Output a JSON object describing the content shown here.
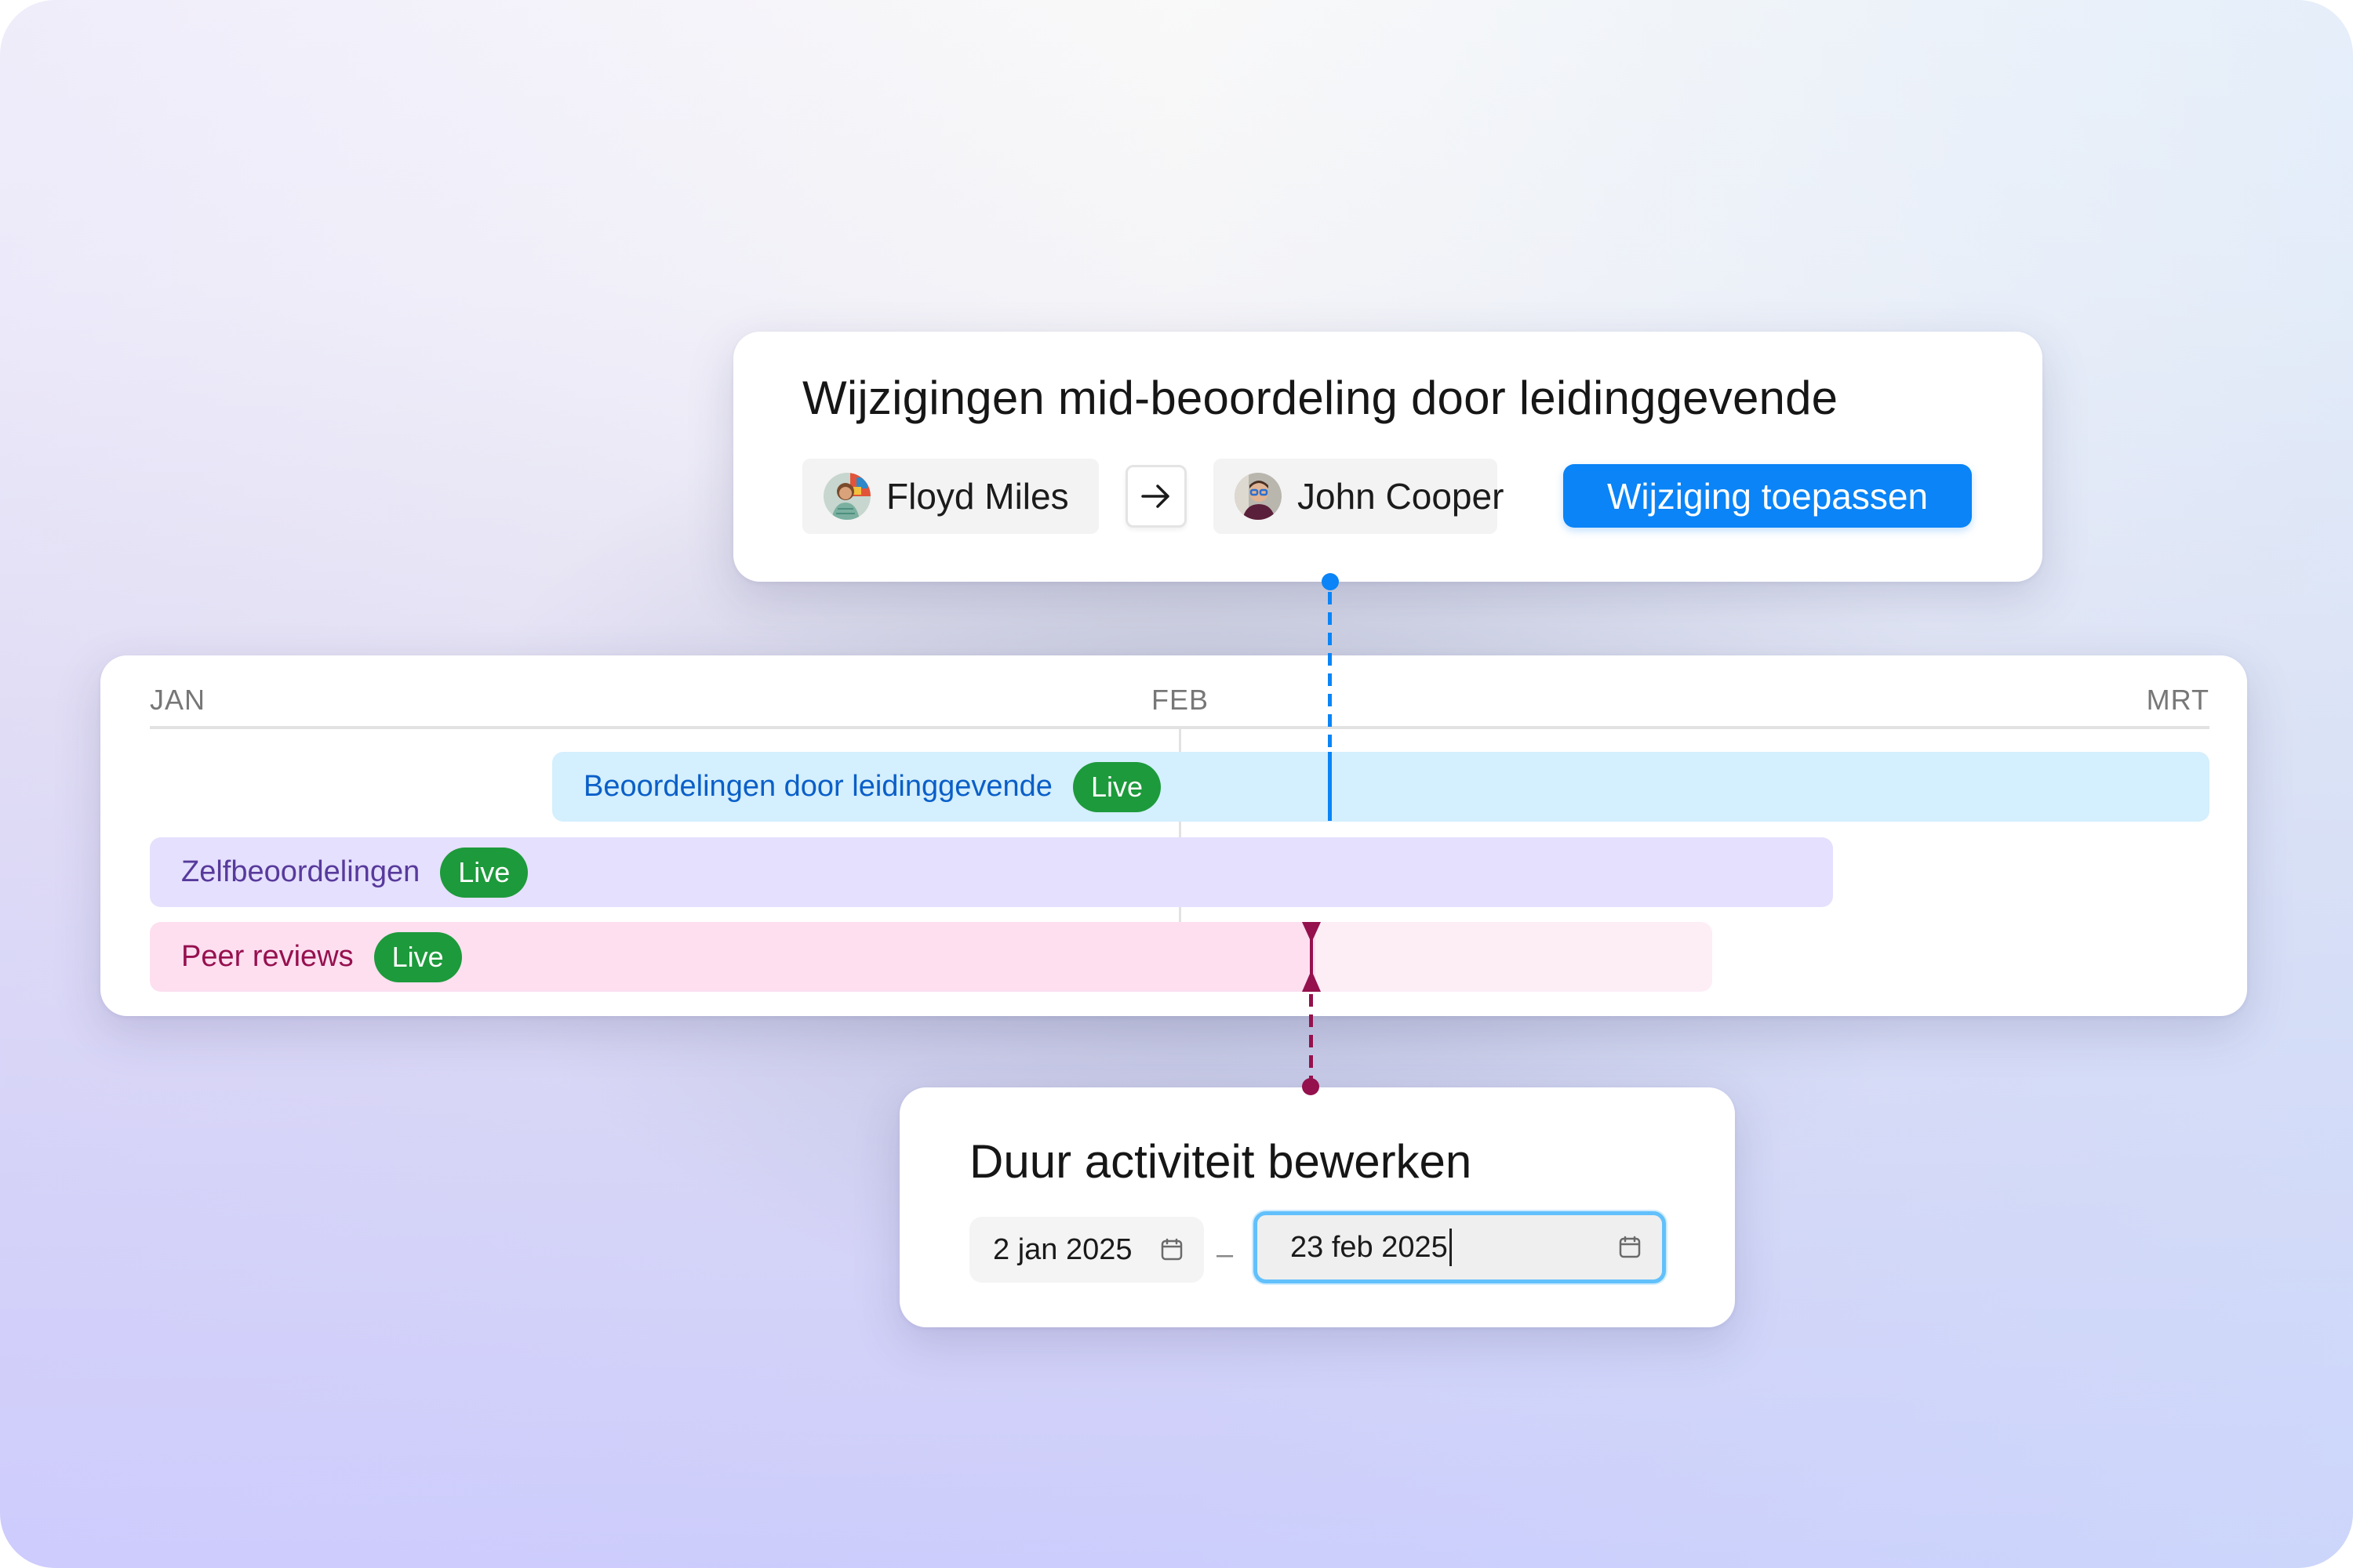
{
  "reassign_card": {
    "title": "Wijzigingen mid-beoordeling door leidinggevende",
    "from_person": {
      "name": "Floyd Miles",
      "avatar": "avatar-floyd-miles"
    },
    "arrow_icon": "arrow-right-icon",
    "to_person": {
      "name": "John Cooper",
      "avatar": "avatar-john-cooper"
    },
    "apply_button_label": "Wijziging toepassen"
  },
  "timeline": {
    "months": [
      "JAN",
      "FEB",
      "MRT"
    ],
    "rows": [
      {
        "label": "Beoordelingen door leidinggevende",
        "status": "Live",
        "color": "#d4effd",
        "text_color": "#0a5fc8"
      },
      {
        "label": "Zelfbeoordelingen",
        "status": "Live",
        "color": "#e5e0fd",
        "text_color": "#573a9c"
      },
      {
        "label": "Peer reviews",
        "status": "Live",
        "color": "#fddff0",
        "text_color": "#96104e"
      }
    ]
  },
  "duration_card": {
    "title": "Duur activiteit bewerken",
    "start_date": "2 jan 2025",
    "separator": "–",
    "end_date": "23 feb 2025",
    "calendar_icon": "calendar-icon"
  },
  "colors": {
    "accent_blue": "#0a84f6",
    "live_green": "#1d9a3b",
    "marker_pink": "#94114d",
    "focus_ring": "#62c0fb"
  }
}
